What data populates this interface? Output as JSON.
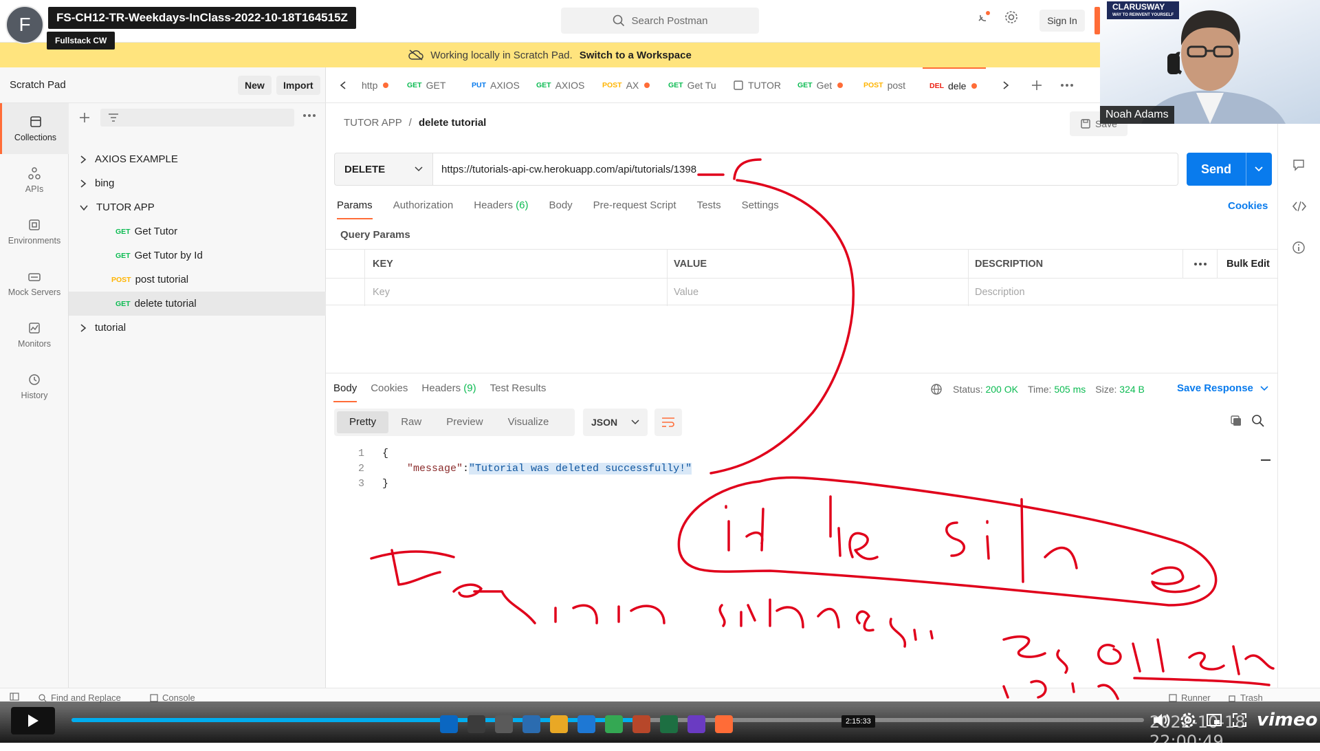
{
  "video": {
    "title": "FS-CH12-TR-Weekdays-InClass-2022-10-18T164515Z",
    "channel": "Fullstack CW",
    "avatar_letter": "F",
    "progress_percent": 54,
    "hover_time": "2:15:33",
    "platform": "vimeo",
    "overlay_timestamp": "2022-10-18 22:00:49"
  },
  "webcam": {
    "presenter_name": "Noah Adams",
    "logo": "CLARUSWAY",
    "logo_tag": "WAY TO REINVENT YOURSELF"
  },
  "topbar": {
    "search_placeholder": "Search Postman",
    "sign_in": "Sign In",
    "icons": [
      "satellite-icon",
      "gear-icon"
    ]
  },
  "banner": {
    "text": "Working locally in Scratch Pad.",
    "link": "Switch to a Workspace"
  },
  "sidebar": {
    "title": "Scratch Pad",
    "new_label": "New",
    "import_label": "Import",
    "rail": [
      {
        "label": "Collections",
        "icon": "collections-icon",
        "active": true
      },
      {
        "label": "APIs",
        "icon": "apis-icon"
      },
      {
        "label": "Environments",
        "icon": "environments-icon"
      },
      {
        "label": "Mock Servers",
        "icon": "mock-servers-icon"
      },
      {
        "label": "Monitors",
        "icon": "monitors-icon"
      },
      {
        "label": "History",
        "icon": "history-icon"
      }
    ],
    "tree": [
      {
        "label": "AXIOS EXAMPLE",
        "type": "folder"
      },
      {
        "label": "bing",
        "type": "folder"
      },
      {
        "label": "TUTOR APP",
        "type": "folder-open"
      },
      {
        "label": "Get Tutor",
        "method": "GET"
      },
      {
        "label": "Get Tutor by Id",
        "method": "GET"
      },
      {
        "label": "post tutorial",
        "method": "POST"
      },
      {
        "label": "delete tutorial",
        "method": "GET",
        "selected": true
      },
      {
        "label": "tutorial",
        "type": "folder"
      }
    ]
  },
  "tabs": [
    {
      "method": "",
      "label": "http",
      "dot": true
    },
    {
      "method": "GET",
      "label": "GET",
      "dot": false
    },
    {
      "method": "PUT",
      "label": "AXIOS",
      "dot": false
    },
    {
      "method": "GET",
      "label": "AXIOS",
      "dot": false
    },
    {
      "method": "POST",
      "label": "AX",
      "dot": true
    },
    {
      "method": "GET",
      "label": "Get Tu",
      "dot": false
    },
    {
      "method": "",
      "label": "TUTOR",
      "dot": false
    },
    {
      "method": "GET",
      "label": "Get",
      "dot": true
    },
    {
      "method": "POST",
      "label": "post",
      "dot": false
    },
    {
      "method": "DEL",
      "label": "dele",
      "dot": true,
      "active": true
    }
  ],
  "request": {
    "breadcrumb_parent": "TUTOR APP",
    "breadcrumb_sep": "/",
    "name": "delete tutorial",
    "save_label": "Save",
    "method": "DELETE",
    "url": "https://tutorials-api-cw.herokuapp.com/api/tutorials/1398",
    "send_label": "Send",
    "tabs": [
      {
        "label": "Params",
        "active": true
      },
      {
        "label": "Authorization"
      },
      {
        "label": "Headers",
        "count": "(6)"
      },
      {
        "label": "Body"
      },
      {
        "label": "Pre-request Script"
      },
      {
        "label": "Tests"
      },
      {
        "label": "Settings"
      }
    ],
    "cookies_label": "Cookies",
    "query_params_title": "Query Params",
    "table": {
      "headers": [
        "KEY",
        "VALUE",
        "DESCRIPTION"
      ],
      "placeholders": [
        "Key",
        "Value",
        "Description"
      ],
      "bulk_edit": "Bulk Edit"
    }
  },
  "response": {
    "tabs": [
      {
        "label": "Body",
        "active": true
      },
      {
        "label": "Cookies"
      },
      {
        "label": "Headers",
        "count": "(9)"
      },
      {
        "label": "Test Results"
      }
    ],
    "status_label": "Status:",
    "status_value": "200 OK",
    "time_label": "Time:",
    "time_value": "505 ms",
    "size_label": "Size:",
    "size_value": "324 B",
    "save_response": "Save Response",
    "views": [
      "Pretty",
      "Raw",
      "Preview",
      "Visualize"
    ],
    "format": "JSON",
    "code": {
      "line1": "{",
      "key": "\"message\"",
      "colon": ": ",
      "value": "\"Tutorial was deleted successfully!\"",
      "line3": "}"
    }
  },
  "statusbar": {
    "find_replace": "Find and Replace",
    "console": "Console",
    "runner": "Runner",
    "trash": "Trash"
  },
  "colors": {
    "accent": "#ff6c37",
    "send_blue": "#097bed",
    "banner_yellow": "#ffe47e",
    "get_green": "#0cbb52",
    "post_yellow": "#ffb400",
    "annotation_red": "#e0001b"
  }
}
